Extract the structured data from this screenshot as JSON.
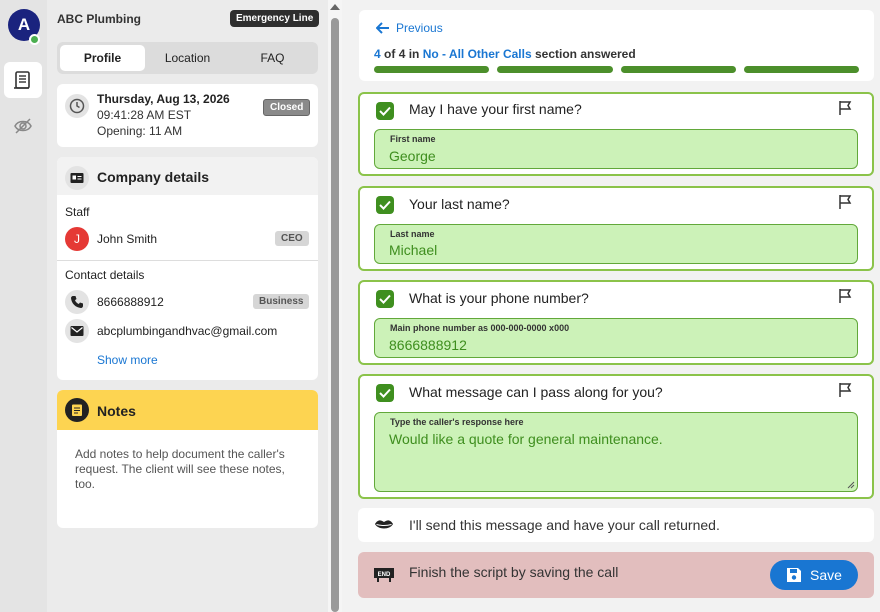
{
  "user": {
    "initial": "A"
  },
  "company": {
    "name": "ABC Plumbing",
    "emergency_label": "Emergency Line"
  },
  "tabs": [
    {
      "label": "Profile"
    },
    {
      "label": "Location"
    },
    {
      "label": "FAQ"
    }
  ],
  "status": {
    "date": "Thursday, Aug 13, 2026",
    "time": "09:41:28 AM EST",
    "opening": "Opening: 11 AM",
    "badge": "Closed"
  },
  "company_details": {
    "title": "Company details",
    "staff_label": "Staff",
    "staff": {
      "initial": "J",
      "name": "John Smith",
      "role": "CEO",
      "avatar_color": "#e53935"
    },
    "contact_label": "Contact details",
    "phone": "8666888912",
    "phone_type": "Business",
    "email": "abcplumbingandhvac@gmail.com",
    "show_more": "Show more"
  },
  "notes": {
    "title": "Notes",
    "placeholder": "Add notes to help document the caller's request. The client will see these notes, too."
  },
  "progress": {
    "previous_label": "Previous",
    "current": "4",
    "of_text": "of 4 in",
    "section": "No - All Other Calls",
    "suffix": "section answered",
    "segments_done": 4,
    "segments_total": 4
  },
  "questions": [
    {
      "question": "May I have your first name?",
      "field_label": "First name",
      "value": "George"
    },
    {
      "question": "Your last name?",
      "field_label": "Last name",
      "value": "Michael"
    },
    {
      "question": "What is your phone number?",
      "field_label": "Main phone number as 000-000-0000 x000",
      "value": "8666888912"
    },
    {
      "question": "What message can I pass along for you?",
      "field_label": "Type the caller's response here",
      "value": "Would like a quote for general maintenance."
    }
  ],
  "script_message": "I'll send this message and have your call returned.",
  "finish": {
    "text": "Finish the script by saving the call",
    "save_label": "Save"
  },
  "colors": {
    "accent": "#1976d2",
    "answered_green": "#3f8f1f",
    "notes_yellow": "#fdd451",
    "end_card": "#e2bebe"
  }
}
